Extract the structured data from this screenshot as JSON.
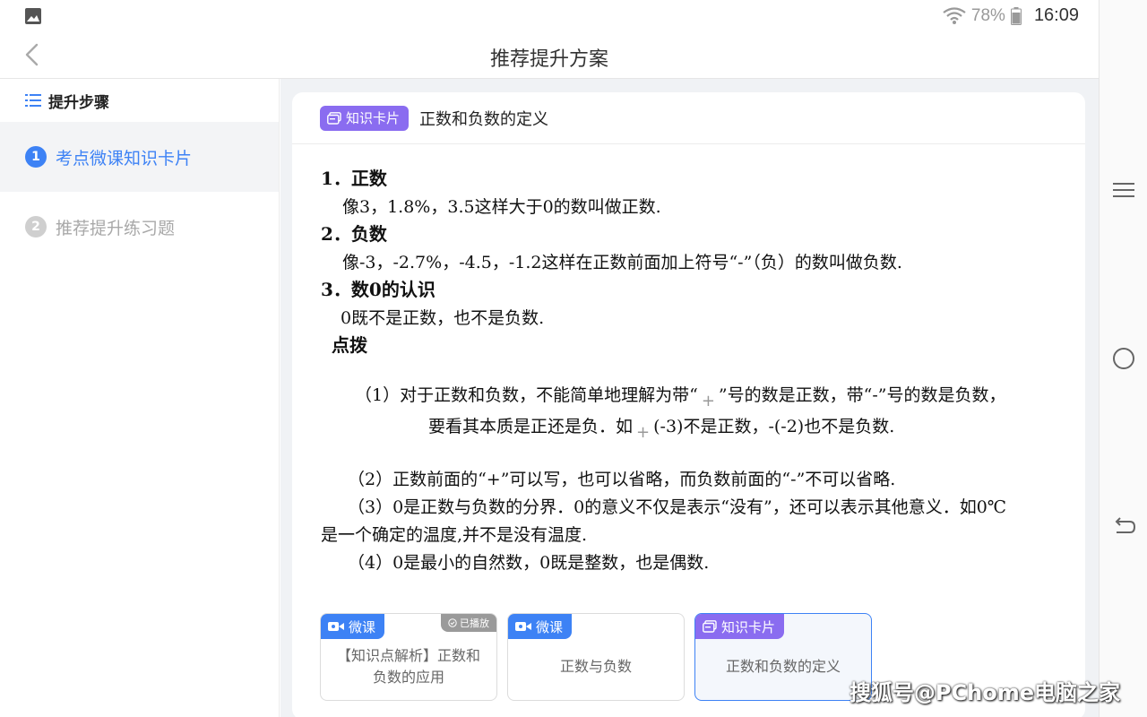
{
  "status_bar": {
    "battery": "78%",
    "time": "16:09"
  },
  "title_bar": {
    "title": "推荐提升方案"
  },
  "sidebar": {
    "heading": "提升步骤",
    "steps": [
      {
        "num": "1",
        "label": "考点微课知识卡片"
      },
      {
        "num": "2",
        "label": "推荐提升练习题"
      }
    ]
  },
  "card": {
    "tag": "知识卡片",
    "title": "正数和负数的定义",
    "lines": [
      "1．正数",
      "像3，1.8%，3.5这样大于0的数叫做正数.",
      "2．负数",
      "像-3，-2.7%，-4.5，-1.2这样在正数前面加上符号“-”（负）的数叫做负数.",
      "3．数0的认识",
      "0既不是正数，也不是负数.",
      "点拨",
      "（1）对于正数和负数，不能简单地理解为带“",
      "”号的数是正数，带“-”号的数是负数，",
      "要看其本质是正还是负．如",
      "(-3)不是正数，-(-2)也不是负数.",
      "（2）正数前面的“+”可以写，也可以省略，而负数前面的“-”不可以省略.",
      "（3）0是正数与负数的分界．0的意义不仅是表示“没有”，还可以表示其他意义．如0℃",
      "是一个确定的温度,并不是没有温度.",
      "（4）0是最小的自然数，0既是整数，也是偶数."
    ],
    "plus_glyph": "+"
  },
  "related": [
    {
      "tag": "微课",
      "badge": "已播放",
      "text": "【知识点解析】正数和负数的应用"
    },
    {
      "tag": "微课",
      "text": "正数与负数"
    },
    {
      "tag": "知识卡片",
      "text": "正数和负数的定义"
    }
  ],
  "watermark": "搜狐号@PChome电脑之家"
}
